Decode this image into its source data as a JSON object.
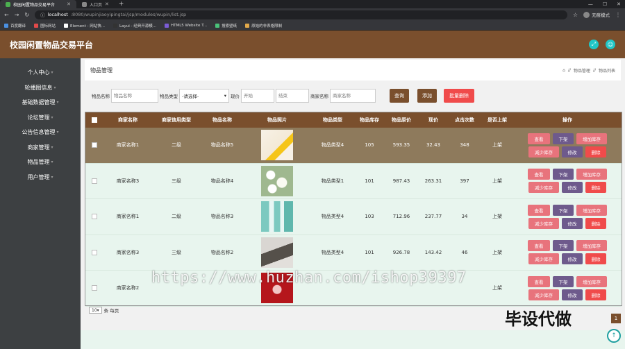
{
  "browser": {
    "tabs": [
      {
        "label": "校园闲置物品交易平台",
        "active": true
      },
      {
        "label": "入口页",
        "active": false
      }
    ],
    "new_tab": "+",
    "url_host": "localhost",
    "url_rest": ":8080/wupinjiaoyipingtai/jsp/modules/wupin/list.jsp",
    "profile_label": "无痕模式",
    "bookmarks": [
      "百度翻译",
      "图标网站",
      "Element - 网站快...",
      "Layui - 经典开源模...",
      "HTML5 Website T...",
      "搜索壁纸",
      "原始的非表格限制"
    ]
  },
  "app": {
    "title": "校园闲置物品交易平台"
  },
  "sidebar": {
    "items": [
      {
        "label": "个人中心"
      },
      {
        "label": "轮播图信息"
      },
      {
        "label": "基础数据管理"
      },
      {
        "label": "论坛管理"
      },
      {
        "label": "公告信息管理"
      },
      {
        "label": "商家管理"
      },
      {
        "label": "物品管理"
      },
      {
        "label": "用户管理"
      }
    ]
  },
  "page": {
    "title": "物品管理",
    "breadcrumb": [
      "物品管理",
      "物品列表"
    ]
  },
  "filter": {
    "name_label": "物品名称",
    "name_placeholder": "物品名称",
    "type_label": "物品类型",
    "type_selected": "-请选择-",
    "price_label": "现价",
    "price_start_placeholder": "开始",
    "price_end_placeholder": "结束",
    "shop_label": "商家名称",
    "shop_placeholder": "商家名称",
    "search_button": "查询",
    "add_button": "添加",
    "batch_delete_button": "批量删除"
  },
  "table": {
    "headers": [
      "商家名称",
      "商家信用类型",
      "物品名称",
      "物品照片",
      "物品类型",
      "物品库存",
      "物品原价",
      "现价",
      "点击次数",
      "是否上架",
      "操作"
    ],
    "rows": [
      {
        "shop": "商家名称1",
        "credit": "二级",
        "name": "物品名称5",
        "type": "物品类型4",
        "stock": "105",
        "orig": "593.35",
        "now": "32.43",
        "clicks": "348",
        "shelf": "上架"
      },
      {
        "shop": "商家名称3",
        "credit": "三级",
        "name": "物品名称4",
        "type": "物品类型1",
        "stock": "101",
        "orig": "987.43",
        "now": "263.31",
        "clicks": "397",
        "shelf": "上架"
      },
      {
        "shop": "商家名称1",
        "credit": "二级",
        "name": "物品名称3",
        "type": "物品类型4",
        "stock": "103",
        "orig": "712.96",
        "now": "237.77",
        "clicks": "34",
        "shelf": "上架"
      },
      {
        "shop": "商家名称3",
        "credit": "三级",
        "name": "物品名称2",
        "type": "物品类型4",
        "stock": "101",
        "orig": "926.78",
        "now": "143.42",
        "clicks": "46",
        "shelf": "上架"
      },
      {
        "shop": "商家名称2",
        "credit": "",
        "name": "",
        "type": "",
        "stock": "",
        "orig": "",
        "now": "",
        "clicks": "",
        "shelf": "上架"
      }
    ],
    "ops": {
      "view": "查看",
      "down": "下架",
      "add_stock": "增加库存",
      "less_stock": "减少库存",
      "edit": "修改",
      "delete": "删除"
    }
  },
  "pager": {
    "page_size": "10",
    "suffix": "条 每页",
    "current_page": "1"
  },
  "overlay": {
    "watermark": "https://www.huzhan.com/ishop39397",
    "stamp": "毕设代做"
  },
  "colors": {
    "brand": "#7a4f2d",
    "sidebar": "#3d4042",
    "accent_red": "#f04b4b",
    "accent_purple": "#6e5a8c",
    "accent_pink": "#e8737c",
    "teal": "#20c6c6"
  }
}
